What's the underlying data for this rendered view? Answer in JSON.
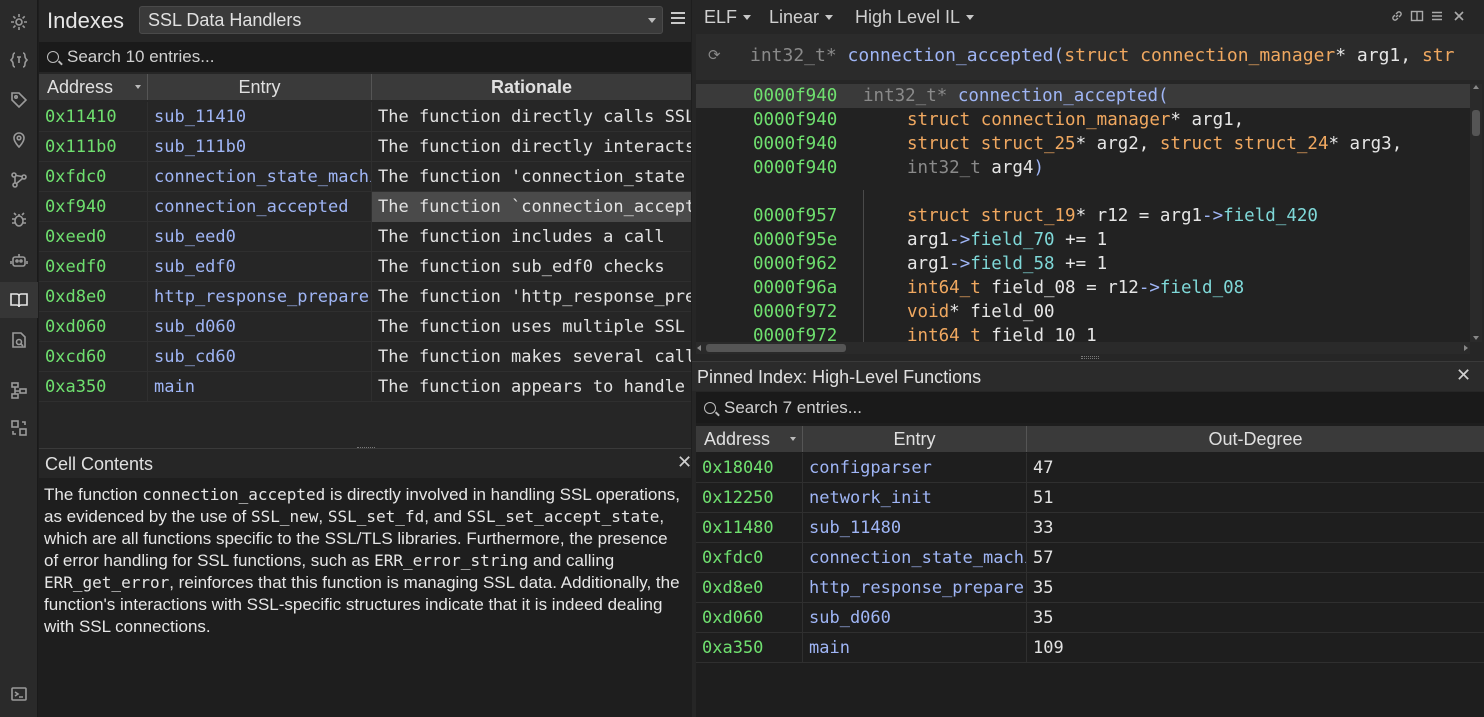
{
  "activity": [
    "variables-icon",
    "tag-icon",
    "location-pin-icon",
    "graph-icon",
    "bug-icon",
    "robot-icon",
    "book-icon",
    "search-doc-icon",
    "hierarchy-icon",
    "compare-icon",
    "terminal-icon"
  ],
  "indexes": {
    "title": "Indexes",
    "selected": "SSL Data Handlers",
    "search_placeholder": "Search 10 entries...",
    "columns": [
      "Address",
      "Entry",
      "Rationale"
    ],
    "rows": [
      {
        "address": "0x11410",
        "entry": "sub_11410",
        "rationale": "The function directly calls SSL"
      },
      {
        "address": "0x111b0",
        "entry": "sub_111b0",
        "rationale": "The function directly interacts"
      },
      {
        "address": "0xfdc0",
        "entry": "connection_state_machine",
        "rationale": "The function 'connection_state"
      },
      {
        "address": "0xf940",
        "entry": "connection_accepted",
        "rationale": "The function `connection_accepted"
      },
      {
        "address": "0xeed0",
        "entry": "sub_eed0",
        "rationale": "The function includes a call"
      },
      {
        "address": "0xedf0",
        "entry": "sub_edf0",
        "rationale": "The function sub_edf0 checks"
      },
      {
        "address": "0xd8e0",
        "entry": "http_response_prepare",
        "rationale": "The function 'http_response_prepare"
      },
      {
        "address": "0xd060",
        "entry": "sub_d060",
        "rationale": "The function uses multiple SSL"
      },
      {
        "address": "0xcd60",
        "entry": "sub_cd60",
        "rationale": "The function makes several calls"
      },
      {
        "address": "0xa350",
        "entry": "main",
        "rationale": "The function appears to handle"
      }
    ]
  },
  "cell": {
    "title": "Cell Contents",
    "parts": [
      "The function ",
      "connection_accepted",
      " is directly involved in handling SSL operations, as evidenced by the use of ",
      "SSL_new",
      ", ",
      "SSL_set_fd",
      ", and ",
      "SSL_set_accept_state",
      ", which are all functions specific to the SSL/TLS libraries. Furthermore, the presence of error handling for SSL functions, such as ",
      "ERR_error_string",
      " and calling ",
      "ERR_get_error",
      ", reinforces that this function is managing SSL data. Additionally, the function's interactions with SSL-specific structures indicate that it is indeed dealing with SSL connections."
    ]
  },
  "code": {
    "toolbar": {
      "format": "ELF",
      "view": "Linear",
      "il": "High Level IL"
    },
    "header": {
      "ret": "int32_t*",
      "name": "connection_accepted",
      "open": "(",
      "kw": "struct",
      "ty": "connection_manager",
      "rest": "* arg1, ",
      "tail": "str"
    },
    "lines": [
      {
        "addr": "0000f940",
        "segs": [
          [
            "dim",
            "int32_t*"
          ],
          [
            "va",
            " "
          ],
          [
            "fn",
            "connection_accepted"
          ],
          [
            "op",
            "("
          ]
        ],
        "indent": 0
      },
      {
        "addr": "0000f940",
        "segs": [
          [
            "kw",
            "struct"
          ],
          [
            "va",
            " "
          ],
          [
            "ty",
            "connection_manager"
          ],
          [
            "va",
            "* arg1,"
          ]
        ],
        "indent": 1
      },
      {
        "addr": "0000f940",
        "segs": [
          [
            "kw",
            "struct"
          ],
          [
            "va",
            " "
          ],
          [
            "ty",
            "struct_25"
          ],
          [
            "va",
            "* arg2, "
          ],
          [
            "kw",
            "struct"
          ],
          [
            "va",
            " "
          ],
          [
            "ty",
            "struct_24"
          ],
          [
            "va",
            "* arg3,"
          ]
        ],
        "indent": 1
      },
      {
        "addr": "0000f940",
        "segs": [
          [
            "dim",
            "int32_t"
          ],
          [
            "va",
            " arg4"
          ],
          [
            "op",
            ")"
          ]
        ],
        "indent": 1
      },
      {
        "addr": "0000f957",
        "segs": [
          [
            "kw",
            "struct"
          ],
          [
            "va",
            " "
          ],
          [
            "ty",
            "struct_19"
          ],
          [
            "va",
            "* r12 = arg1"
          ],
          [
            "op",
            "->"
          ],
          [
            "fld",
            "field_420"
          ]
        ],
        "indent": 1
      },
      {
        "addr": "0000f95e",
        "segs": [
          [
            "va",
            "arg1"
          ],
          [
            "op",
            "->"
          ],
          [
            "fld",
            "field_70"
          ],
          [
            "va",
            " += 1"
          ]
        ],
        "indent": 1
      },
      {
        "addr": "0000f962",
        "segs": [
          [
            "va",
            "arg1"
          ],
          [
            "op",
            "->"
          ],
          [
            "fld",
            "field_58"
          ],
          [
            "va",
            " += 1"
          ]
        ],
        "indent": 1
      },
      {
        "addr": "0000f96a",
        "segs": [
          [
            "ty",
            "int64_t"
          ],
          [
            "va",
            " field_08 = r12"
          ],
          [
            "op",
            "->"
          ],
          [
            "fld",
            "field_08"
          ]
        ],
        "indent": 1
      },
      {
        "addr": "0000f972",
        "segs": [
          [
            "ty",
            "void"
          ],
          [
            "va",
            "* field_00"
          ]
        ],
        "indent": 1
      },
      {
        "addr": "0000f972",
        "segs": [
          [
            "ty",
            "int64_t"
          ],
          [
            "va",
            " field_10_1"
          ]
        ],
        "indent": 1
      }
    ]
  },
  "pinned": {
    "title": "Pinned Index: High-Level Functions",
    "search_placeholder": "Search 7 entries...",
    "columns": [
      "Address",
      "Entry",
      "Out-Degree"
    ],
    "rows": [
      {
        "address": "0x18040",
        "entry": "configparser",
        "degree": "47"
      },
      {
        "address": "0x12250",
        "entry": "network_init",
        "degree": "51"
      },
      {
        "address": "0x11480",
        "entry": "sub_11480",
        "degree": "33"
      },
      {
        "address": "0xfdc0",
        "entry": "connection_state_machine",
        "degree": "57"
      },
      {
        "address": "0xd8e0",
        "entry": "http_response_prepare",
        "degree": "35"
      },
      {
        "address": "0xd060",
        "entry": "sub_d060",
        "degree": "35"
      },
      {
        "address": "0xa350",
        "entry": "main",
        "degree": "109"
      }
    ]
  }
}
